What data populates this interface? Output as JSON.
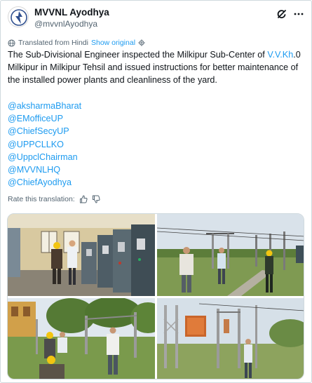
{
  "post": {
    "author": {
      "display_name": "MVVNL Ayodhya",
      "handle": "@mvvnlAyodhya"
    },
    "translation_notice": {
      "label": "Translated from Hindi",
      "show_original": "Show original"
    },
    "text": {
      "part1": "The Sub-Divisional Engineer inspected the Milkipur Sub-Center of ",
      "link": "V.V.Kh",
      "part2": ".0 Milkipur in Milkipur Tehsil and issued instructions for better maintenance of the installed power plants and cleanliness of the yard."
    },
    "mentions": [
      "@aksharmaBharat",
      "@EMofficeUP",
      "@ChiefSecyUP",
      "@UPPCLLKO",
      "@UppclChairman",
      "@MVVNLHQ",
      "@ChiefAyodhya"
    ],
    "rate_translation": "Rate this translation:"
  },
  "colors": {
    "link": "#1d9bf0",
    "text": "#0f1419",
    "muted": "#536471",
    "border": "#cfd9de"
  },
  "icons": [
    "avatar-logo",
    "grok-icon",
    "more-icon",
    "translate-globe-icon",
    "gear-icon",
    "thumbs-up-icon",
    "thumbs-down-icon"
  ]
}
